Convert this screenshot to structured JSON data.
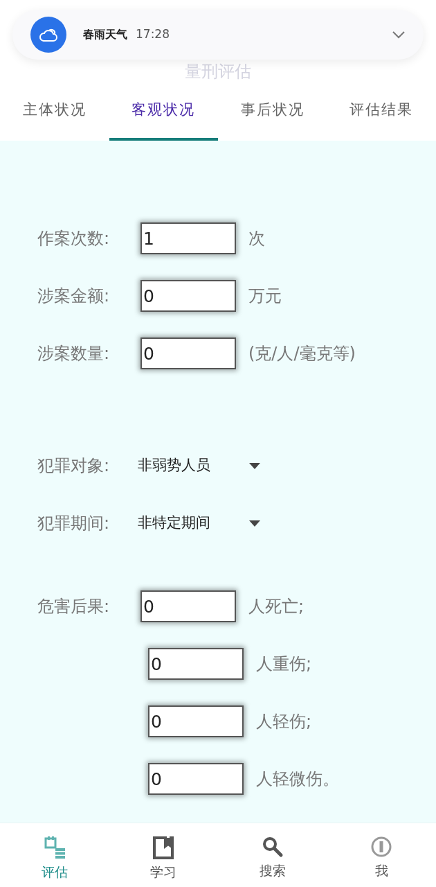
{
  "notification": {
    "app": "春雨天气",
    "time": "17:28"
  },
  "page_title": "量刑评估",
  "tabs": [
    {
      "label": "主体状况",
      "selected": false
    },
    {
      "label": "客观状况",
      "selected": true
    },
    {
      "label": "事后状况",
      "selected": false
    },
    {
      "label": "评估结果",
      "selected": false
    }
  ],
  "fields": [
    {
      "label": "作案次数:",
      "value": "1",
      "unit": "次"
    },
    {
      "label": "涉案金额:",
      "value": "0",
      "unit": "万元"
    },
    {
      "label": "涉案数量:",
      "value": "0",
      "unit": "(克/人/毫克等)"
    }
  ],
  "selects": [
    {
      "label": "犯罪对象:",
      "value": "非弱势人员"
    },
    {
      "label": "犯罪期间:",
      "value": "非特定期间"
    }
  ],
  "harm": {
    "label": "危害后果:",
    "rows": [
      {
        "value": "0",
        "unit": "人死亡;"
      },
      {
        "value": "0",
        "unit": "人重伤;"
      },
      {
        "value": "0",
        "unit": "人轻伤;"
      },
      {
        "value": "0",
        "unit": "人轻微伤。"
      }
    ]
  },
  "bottom_nav": [
    {
      "label": "评估",
      "selected": true
    },
    {
      "label": "学习",
      "selected": false
    },
    {
      "label": "搜索",
      "selected": false
    },
    {
      "label": "我",
      "selected": false
    }
  ]
}
